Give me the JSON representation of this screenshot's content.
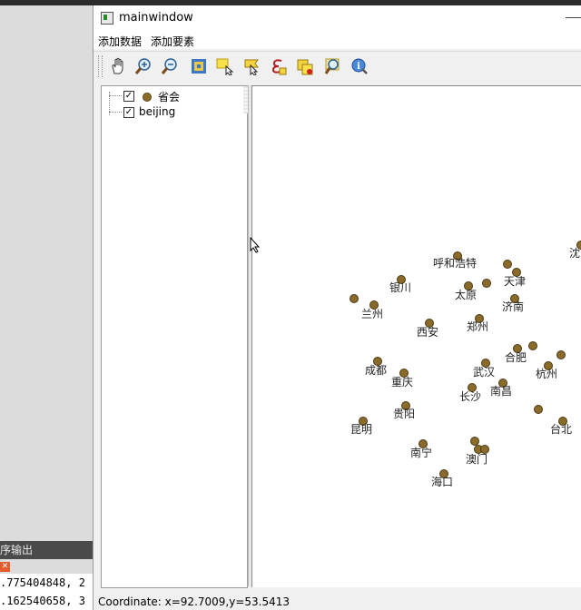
{
  "window": {
    "title": "mainwindow",
    "menus": [
      "添加数据",
      "添加要素"
    ]
  },
  "toolbar": {
    "tools": [
      "pan-icon",
      "zoom-in-icon",
      "zoom-out-icon",
      "full-extent-icon",
      "select-icon",
      "identify-flag-icon",
      "edit-vertex-icon",
      "add-feature-icon",
      "search-icon",
      "info-icon"
    ]
  },
  "layers": [
    {
      "label": "省会",
      "checked": true,
      "symbol_color": "#8b6b2a"
    },
    {
      "label": "beijing",
      "checked": true
    }
  ],
  "map": {
    "point_color": "#8b6b2a",
    "cities": [
      {
        "name": "沈",
        "dot": [
          638,
          269
        ],
        "label": [
          626,
          270
        ]
      },
      {
        "name": "呼和浩特",
        "dot": [
          502,
          281
        ],
        "label": [
          476,
          281
        ]
      },
      {
        "name": "",
        "dot": [
          557,
          290
        ]
      },
      {
        "name": "天津",
        "dot": [
          567,
          299
        ],
        "label": [
          554,
          301
        ]
      },
      {
        "name": "银川",
        "dot": [
          440,
          307
        ],
        "label": [
          428,
          308
        ]
      },
      {
        "name": "",
        "dot": [
          534,
          311
        ]
      },
      {
        "name": "太原",
        "dot": [
          514,
          314
        ],
        "label": [
          500,
          316
        ]
      },
      {
        "name": "",
        "dot": [
          388,
          328
        ]
      },
      {
        "name": "济南",
        "dot": [
          565,
          328
        ],
        "label": [
          552,
          329
        ]
      },
      {
        "name": "兰州",
        "dot": [
          410,
          335
        ],
        "label": [
          397,
          337
        ]
      },
      {
        "name": "郑州",
        "dot": [
          526,
          350
        ],
        "label": [
          513,
          351
        ]
      },
      {
        "name": "西安",
        "dot": [
          471,
          355
        ],
        "label": [
          458,
          357
        ]
      },
      {
        "name": "",
        "dot": [
          585,
          380
        ]
      },
      {
        "name": "合肥",
        "dot": [
          568,
          383
        ],
        "label": [
          555,
          385
        ]
      },
      {
        "name": "",
        "dot": [
          616,
          390
        ]
      },
      {
        "name": "成都",
        "dot": [
          414,
          397
        ],
        "label": [
          401,
          399
        ]
      },
      {
        "name": "武汉",
        "dot": [
          533,
          399
        ],
        "label": [
          520,
          401
        ]
      },
      {
        "name": "杭州",
        "dot": [
          602,
          402
        ],
        "label": [
          589,
          403
        ]
      },
      {
        "name": "重庆",
        "dot": [
          443,
          410
        ],
        "label": [
          430,
          412
        ]
      },
      {
        "name": "南昌",
        "dot": [
          552,
          421
        ],
        "label": [
          539,
          422
        ]
      },
      {
        "name": "长沙",
        "dot": [
          518,
          426
        ],
        "label": [
          505,
          428
        ]
      },
      {
        "name": "贵阳",
        "dot": [
          445,
          446
        ],
        "label": [
          432,
          447
        ]
      },
      {
        "name": "",
        "dot": [
          591,
          450
        ]
      },
      {
        "name": "台北",
        "dot": [
          618,
          463
        ],
        "label": [
          605,
          464
        ]
      },
      {
        "name": "昆明",
        "dot": [
          398,
          463
        ],
        "label": [
          385,
          464
        ]
      },
      {
        "name": "",
        "dot": [
          521,
          485
        ]
      },
      {
        "name": "南宁",
        "dot": [
          464,
          488
        ],
        "label": [
          451,
          490
        ]
      },
      {
        "name": "",
        "dot": [
          525,
          494
        ]
      },
      {
        "name": "澳门",
        "dot": [
          532,
          494
        ],
        "label": [
          512,
          497
        ]
      },
      {
        "name": "海口",
        "dot": [
          487,
          521
        ],
        "label": [
          474,
          522
        ]
      }
    ]
  },
  "status": {
    "coordinate": "Coordinate: x=92.7009,y=53.5413"
  },
  "background_ide": {
    "panel_title": "序输出",
    "output_lines": [
      ".775404848, 2",
      ".162540658, 3"
    ]
  }
}
